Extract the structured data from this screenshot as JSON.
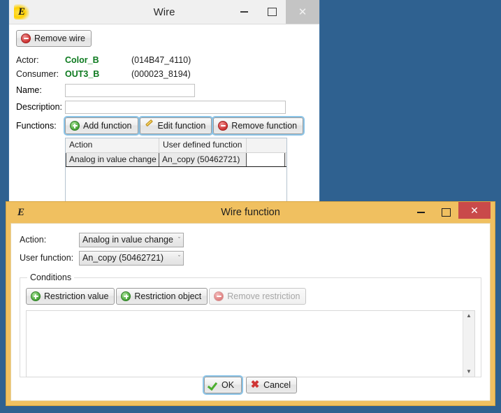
{
  "desktop": {
    "background_color": "#2f6190"
  },
  "wire_window": {
    "title": "Wire",
    "app_icon": "E",
    "controls": {
      "minimize": "–",
      "maximize": "□",
      "close": "✕"
    },
    "remove_wire_button": "Remove wire",
    "actor": {
      "label": "Actor:",
      "name": "Color_B",
      "id": "(014B47_4110)"
    },
    "consumer": {
      "label": "Consumer:",
      "name": "OUT3_B",
      "id": "(000023_8194)"
    },
    "name_field": {
      "label": "Name:",
      "value": "",
      "placeholder": ""
    },
    "description_field": {
      "label": "Description:",
      "value": "",
      "placeholder": ""
    },
    "functions": {
      "label": "Functions:",
      "add_button": "Add function",
      "edit_button": "Edit function",
      "remove_button": "Remove function",
      "table": {
        "columns": [
          "Action",
          "User defined function",
          ""
        ],
        "rows": [
          {
            "action": "Analog in value change",
            "user_function": "An_copy (50462721)",
            "extra": ""
          }
        ]
      }
    }
  },
  "wire_function_dialog": {
    "title": "Wire function",
    "app_icon": "E",
    "controls": {
      "minimize": "–",
      "maximize": "□",
      "close": "✕"
    },
    "close_color": "#c94a4a",
    "frame_color": "#f0c060",
    "action": {
      "label": "Action:",
      "value": "Analog in value change",
      "chevron": "ˇ"
    },
    "user_function": {
      "label": "User function:",
      "value": "An_copy (50462721)",
      "chevron": "ˇ"
    },
    "conditions": {
      "legend": "Conditions",
      "restriction_value_button": "Restriction value",
      "restriction_object_button": "Restriction object",
      "remove_restriction_button": "Remove restriction",
      "remove_restriction_enabled": false,
      "list_items": [],
      "scrollbar": {
        "up": "▲",
        "down": "▼"
      }
    },
    "footer": {
      "ok_button": "OK",
      "cancel_button": "Cancel"
    }
  }
}
